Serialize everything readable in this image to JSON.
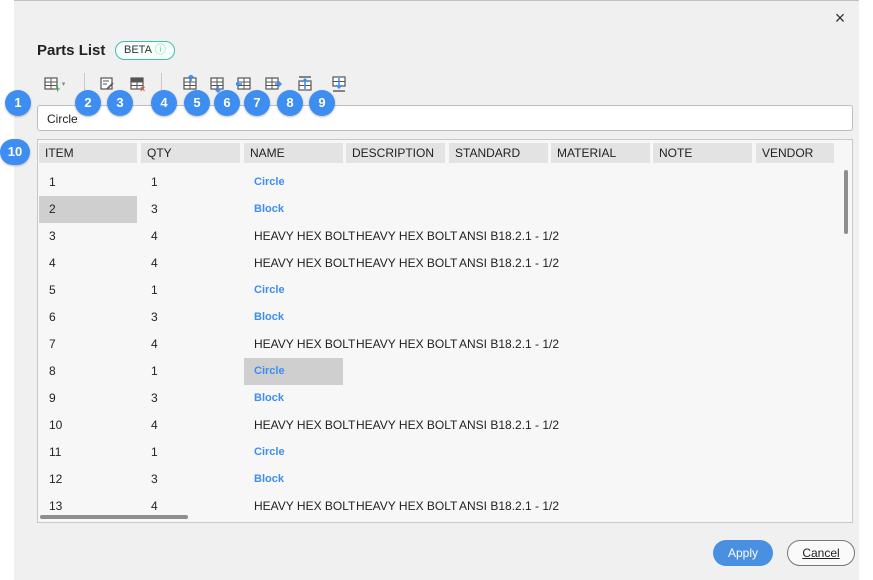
{
  "window": {
    "close_glyph": "×"
  },
  "header": {
    "title": "Parts List",
    "beta_label": "BETA",
    "info_glyph": "ⓘ"
  },
  "toolbar": {
    "tools": [
      {
        "icon": "insert-table-icon",
        "badge": "1"
      },
      {
        "icon": "edit-table-icon",
        "badge": "2"
      },
      {
        "icon": "delete-table-icon",
        "badge": "3"
      },
      {
        "icon": "insert-row-above-icon",
        "badge": "4"
      },
      {
        "icon": "insert-row-below-icon",
        "badge": "5"
      },
      {
        "icon": "insert-column-left-icon",
        "badge": "6"
      },
      {
        "icon": "insert-column-right-icon",
        "badge": "7"
      },
      {
        "icon": "move-row-up-icon",
        "badge": "8"
      },
      {
        "icon": "move-row-down-icon",
        "badge": "9"
      }
    ],
    "header_badge": "10"
  },
  "formula_bar": {
    "value": "Circle"
  },
  "table": {
    "columns": [
      "ITEM",
      "QTY",
      "NAME",
      "DESCRIPTION",
      "STANDARD",
      "MATERIAL",
      "NOTE",
      "VENDOR"
    ],
    "rows": [
      [
        "1",
        "1",
        "Circle",
        "",
        "",
        "",
        "",
        ""
      ],
      [
        "2",
        "3",
        "Block",
        "",
        "",
        "",
        "",
        ""
      ],
      [
        "3",
        "4",
        "HEAVY HEX BOLT",
        "HEAVY HEX BOLT",
        "ANSI B18.2.1 - 1/2",
        "",
        "",
        ""
      ],
      [
        "4",
        "4",
        "HEAVY HEX BOLT",
        "HEAVY HEX BOLT",
        "ANSI B18.2.1 - 1/2",
        "",
        "",
        ""
      ],
      [
        "5",
        "1",
        "Circle",
        "",
        "",
        "",
        "",
        ""
      ],
      [
        "6",
        "3",
        "Block",
        "",
        "",
        "",
        "",
        ""
      ],
      [
        "7",
        "4",
        "HEAVY HEX BOLT",
        "HEAVY HEX BOLT",
        "ANSI B18.2.1 - 1/2",
        "",
        "",
        ""
      ],
      [
        "8",
        "1",
        "Circle",
        "",
        "",
        "",
        "",
        ""
      ],
      [
        "9",
        "3",
        "Block",
        "",
        "",
        "",
        "",
        ""
      ],
      [
        "10",
        "4",
        "HEAVY HEX BOLT",
        "HEAVY HEX BOLT",
        "ANSI B18.2.1 - 1/2",
        "",
        "",
        ""
      ],
      [
        "11",
        "1",
        "Circle",
        "",
        "",
        "",
        "",
        ""
      ],
      [
        "12",
        "3",
        "Block",
        "",
        "",
        "",
        "",
        ""
      ],
      [
        "13",
        "4",
        "HEAVY HEX BOLT",
        "HEAVY HEX BOLT",
        "ANSI B18.2.1 - 1/2",
        "",
        "",
        ""
      ]
    ],
    "link_values": [
      "Circle",
      "Block"
    ]
  },
  "footer": {
    "apply_label": "Apply",
    "cancel_label": "Cancel"
  },
  "colors": {
    "accent": "#3d8ef0",
    "apply": "#4a90e2",
    "beta_border": "#3fbfa6",
    "selection": "#cfcfcf"
  }
}
